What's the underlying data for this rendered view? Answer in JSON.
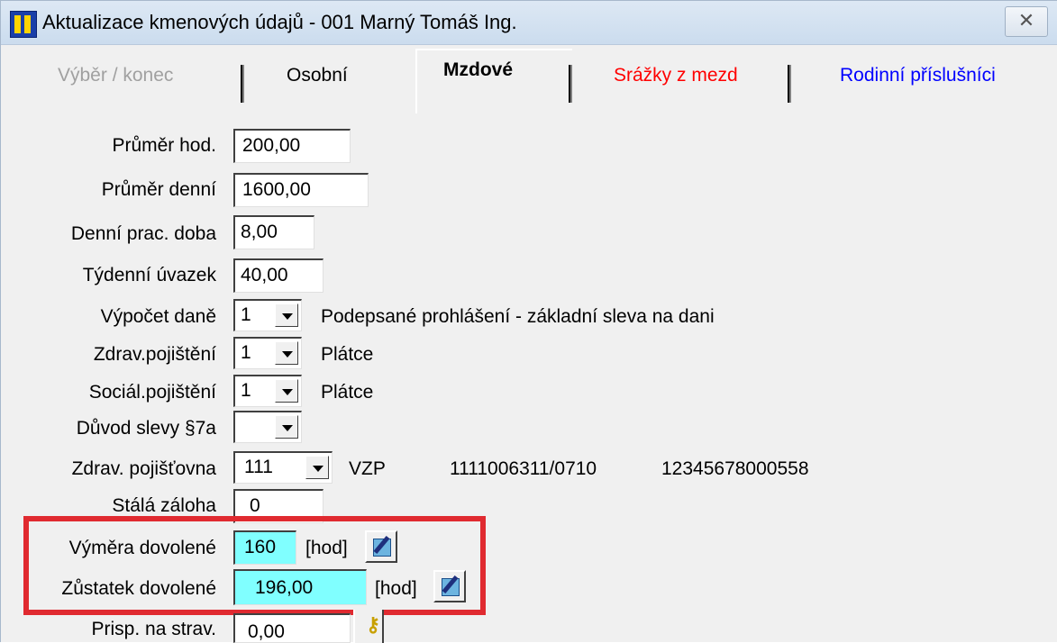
{
  "window": {
    "title": "Aktualizace kmenových údajů - 001 Marný Tomáš Ing.",
    "close_glyph": "✕"
  },
  "tabs": [
    {
      "label": "Výběr / konec",
      "color": "#a0a0a0",
      "state": "disabled"
    },
    {
      "label": "Osobní",
      "color": "#000000",
      "state": "normal"
    },
    {
      "label": "Mzdové",
      "color": "#000000",
      "state": "active"
    },
    {
      "label": "Srážky z mezd",
      "color": "#ff0000",
      "state": "normal"
    },
    {
      "label": "Rodinní příslušníci",
      "color": "#0000ff",
      "state": "normal"
    }
  ],
  "form": {
    "prumer_hod": {
      "label": "Průměr hod.",
      "value": "200,00"
    },
    "prumer_denni": {
      "label": "Průměr denní",
      "value": "1600,00"
    },
    "denni_prac_doba": {
      "label": "Denní prac. doba",
      "value": "8,00"
    },
    "tydenni_uvazek": {
      "label": "Týdenní úvazek",
      "value": "40,00"
    },
    "vypocet_dane": {
      "label": "Výpočet daně",
      "value": "1",
      "description": "Podepsané prohlášení - základní sleva na dani"
    },
    "zdrav_pojisteni": {
      "label": "Zdrav.pojištění",
      "value": "1",
      "description": "Plátce"
    },
    "social_pojisteni": {
      "label": "Sociál.pojištění",
      "value": "1",
      "description": "Plátce"
    },
    "duvod_slevy": {
      "label": "Důvod slevy §7a",
      "value": ""
    },
    "zdrav_pojistovna": {
      "label": "Zdrav. pojišťovna",
      "value": "111",
      "name": "VZP",
      "account": "1111006311/0710",
      "code": "12345678000558"
    },
    "stala_zaloha": {
      "label": "Stálá záloha",
      "value": "0"
    },
    "vymera_dovolene": {
      "label": "Výměra dovolené",
      "value": "160",
      "unit": "[hod]"
    },
    "zustatek_dovolene": {
      "label": "Zůstatek dovolené",
      "value": "196,00",
      "unit": "[hod]"
    },
    "prisp_na_strav": {
      "label": "Prisp. na strav.",
      "value": "0,00"
    }
  },
  "colors": {
    "highlight_field": "#80ffff",
    "annotation_frame": "#e02a30"
  },
  "icons": {
    "edit": "edit-icon",
    "key": "key-icon",
    "app": "app-people-icon"
  }
}
